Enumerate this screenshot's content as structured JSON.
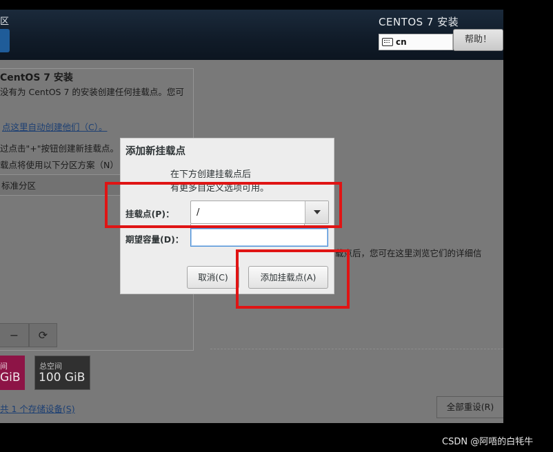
{
  "banner": {
    "title_fragment": "区",
    "product_title": "CENTOS 7 安装",
    "keyboard_layout": "cn",
    "help_label": "帮助！"
  },
  "left_panel": {
    "title": "CentOS 7 安装",
    "description": "没有为 CentOS 7 的安装创建任何挂载点。您可",
    "auto_create_link": "点这里自动创建他们（C）。",
    "hint_add": "过点击\"+\"按钮创建新挂载点。",
    "hint_scheme": "载点将使用以下分区方案（N）",
    "scheme_value": "标准分区",
    "buttons": {
      "remove": "−",
      "refresh": "⟳"
    },
    "available_space": {
      "label": "间",
      "value": "GiB"
    },
    "total_space": {
      "label": "总空间",
      "value": "100 GiB"
    },
    "storage_link": "共 1 个存储设备(S)"
  },
  "right_panel": {
    "info_text": "载点后，您可在这里浏览它们的详细信",
    "reset_all_label": "全部重设(R)"
  },
  "dialog": {
    "title": "添加新挂载点",
    "message_line1": "在下方创建挂载点后",
    "message_line2": "有更多自定义选项可用。",
    "mount_point_label": "挂载点(P)：",
    "mount_point_value": "/",
    "capacity_label": "期望容量(D)：",
    "capacity_value": "",
    "cancel_label": "取消(C)",
    "add_label": "添加挂载点(A)"
  },
  "watermark": "CSDN @阿唔的白牦牛",
  "colors": {
    "annotation_red": "#e01414",
    "link_blue": "#1c3f73",
    "available_space_bg": "#8d1446",
    "focus_blue": "#4a90d9"
  }
}
